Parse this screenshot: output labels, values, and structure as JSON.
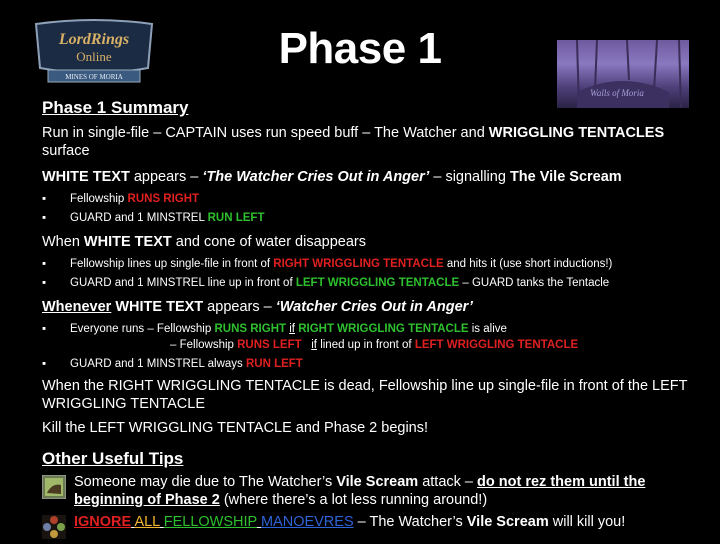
{
  "header": {
    "title": "Phase 1",
    "logo_alt": "The Lord of the Rings Online - Mines of Moria logo",
    "image_alt": "Watcher area screenshot"
  },
  "summary": {
    "heading": "Phase 1 Summary",
    "intro": {
      "t1": "Run in single-file – CAPTAIN uses run speed buff – The Watcher and ",
      "t2": "WRIGGLING TENTACLES",
      "t3": " surface"
    },
    "white_text": {
      "b1": "WHITE TEXT",
      "t1": " appears – ",
      "quote": "‘The Watcher Cries Out in Anger’",
      "t2": " – signalling ",
      "b2": "The Vile Scream"
    },
    "bullets1": [
      {
        "text": "Fellowship ",
        "hl": "RUNS RIGHT",
        "color": "red"
      },
      {
        "text": "GUARD and 1 MINSTREL ",
        "hl": "RUN LEFT",
        "color": "green"
      }
    ],
    "disappears": {
      "t1": "When ",
      "b1": "WHITE TEXT",
      "t2": " and cone of water disappears"
    },
    "bullets2": [
      {
        "pre": "Fellowship lines up single-file in front of ",
        "hl": "RIGHT WRIGGLING TENTACLE",
        "post": " and hits it (use short inductions!)",
        "color": "red"
      },
      {
        "pre": "GUARD and 1 MINSTREL line up in front of ",
        "hl": "LEFT WRIGGLING TENTACLE",
        "post": " – GUARD tanks the Tentacle",
        "color": "green"
      }
    ],
    "whenever": {
      "u1": "Whenever",
      "b1": " WHITE TEXT",
      "t1": " appears – ",
      "quote": "‘Watcher Cries Out in Anger’"
    },
    "bullets3": {
      "everyone": "Everyone runs  –  Fellowship ",
      "runs_right": "RUNS RIGHT",
      "if1": "if",
      "right_tentacle": "RIGHT WRIGGLING TENTACLE",
      "alive": " is alive",
      "line2_pre": "–  Fellowship  ",
      "runs_left": "RUNS LEFT",
      "if2": "if",
      "lined": " lined up in front of ",
      "left_tentacle": "LEFT WRIGGLING TENTACLE",
      "guard": "GUARD and 1 MINSTREL always ",
      "run_left": "RUN LEFT"
    },
    "dead": "When the RIGHT WRIGGLING TENTACLE is dead, Fellowship line up single-file in front of the LEFT WRIGGLING TENTACLE",
    "kill": "Kill the LEFT WRIGGLING TENTACLE and Phase 2 begins!"
  },
  "tips": {
    "heading": "Other Useful Tips",
    "tip1": {
      "t1": "Someone may die due to The Watcher’s ",
      "b1": "Vile Scream",
      "t2": " attack – ",
      "bu": "do not rez them until the beginning of Phase 2",
      "t3": " (where there’s a lot less running around!)"
    },
    "tip2": {
      "w1": "IGNORE",
      "w2": "ALL",
      "w3": "FELLOWSHIP",
      "w4": "MANOEVRES",
      "t1": " – The Watcher’s ",
      "b1": "Vile Scream",
      "t2": " will kill you!"
    }
  },
  "bullet_char": "▪",
  "colors": {
    "red": "#e02020",
    "green": "#2ec02e",
    "yellow": "#f2b531",
    "blue": "#2f63d8",
    "background": "#000000",
    "text": "#ffffff"
  }
}
